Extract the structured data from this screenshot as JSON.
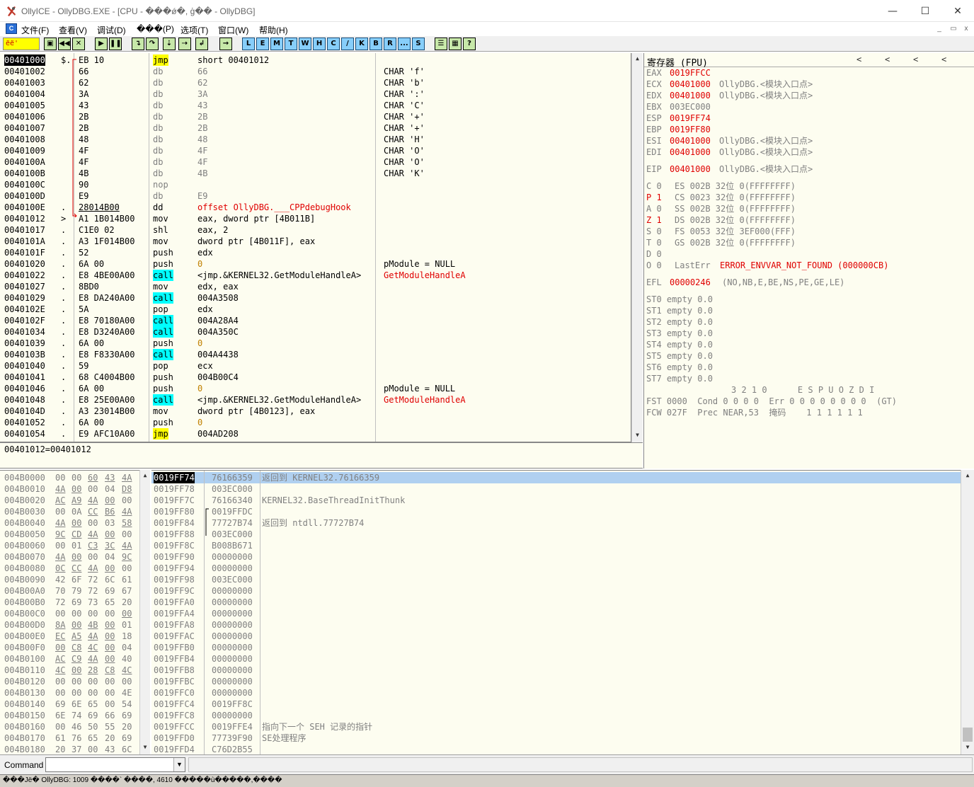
{
  "window": {
    "title": "OllyICE - OllyDBG.EXE - [CPU - ���ǿ�, ģ�� - OllyDBG]",
    "min": "—",
    "max": "☐",
    "close": "✕"
  },
  "menu": {
    "items": [
      "文件(F)",
      "查看(V)",
      "调试(D)",
      "���(P)",
      "选项(T)",
      "窗口(W)",
      "帮助(H)"
    ],
    "mdi": [
      "_",
      "▭",
      "x"
    ]
  },
  "toolbar": {
    "status_text": "ёё'",
    "letters": [
      "L",
      "E",
      "M",
      "T",
      "W",
      "H",
      "C",
      "/",
      "K",
      "B",
      "R",
      "...",
      "S"
    ]
  },
  "disasm": {
    "rows": [
      {
        "addr": "00401000",
        "m": "$.",
        "hex": "EB 10",
        "op": "jmp",
        "arg": "short 00401012",
        "cmt": "",
        "sel": true
      },
      {
        "addr": "00401002",
        "m": "",
        "hex": "66",
        "op": "db",
        "arg": "66",
        "cmt": "CHAR 'f'"
      },
      {
        "addr": "00401003",
        "m": "",
        "hex": "62",
        "op": "db",
        "arg": "62",
        "cmt": "CHAR 'b'"
      },
      {
        "addr": "00401004",
        "m": "",
        "hex": "3A",
        "op": "db",
        "arg": "3A",
        "cmt": "CHAR ':'"
      },
      {
        "addr": "00401005",
        "m": "",
        "hex": "43",
        "op": "db",
        "arg": "43",
        "cmt": "CHAR 'C'"
      },
      {
        "addr": "00401006",
        "m": "",
        "hex": "2B",
        "op": "db",
        "arg": "2B",
        "cmt": "CHAR '+'"
      },
      {
        "addr": "00401007",
        "m": "",
        "hex": "2B",
        "op": "db",
        "arg": "2B",
        "cmt": "CHAR '+'"
      },
      {
        "addr": "00401008",
        "m": "",
        "hex": "48",
        "op": "db",
        "arg": "48",
        "cmt": "CHAR 'H'"
      },
      {
        "addr": "00401009",
        "m": "",
        "hex": "4F",
        "op": "db",
        "arg": "4F",
        "cmt": "CHAR 'O'"
      },
      {
        "addr": "0040100A",
        "m": "",
        "hex": "4F",
        "op": "db",
        "arg": "4F",
        "cmt": "CHAR 'O'"
      },
      {
        "addr": "0040100B",
        "m": "",
        "hex": "4B",
        "op": "db",
        "arg": "4B",
        "cmt": "CHAR 'K'"
      },
      {
        "addr": "0040100C",
        "m": "",
        "hex": "90",
        "op": "nop",
        "arg": "",
        "cmt": ""
      },
      {
        "addr": "0040100D",
        "m": "",
        "hex": "E9",
        "op": "db",
        "arg": "E9",
        "cmt": ""
      },
      {
        "addr": "0040100E",
        "m": ".",
        "hex": "28014B00",
        "op": "dd",
        "arg": "offset OllyDBG.___CPPdebugHook",
        "cmt": ""
      },
      {
        "addr": "00401012",
        "m": ">",
        "hex": "A1 1B014B00",
        "op": "mov",
        "arg": "eax, dword ptr [4B011B]",
        "cmt": ""
      },
      {
        "addr": "00401017",
        "m": ".",
        "hex": "C1E0 02",
        "op": "shl",
        "arg": "eax, 2",
        "cmt": ""
      },
      {
        "addr": "0040101A",
        "m": ".",
        "hex": "A3 1F014B00",
        "op": "mov",
        "arg": "dword ptr [4B011F], eax",
        "cmt": ""
      },
      {
        "addr": "0040101F",
        "m": ".",
        "hex": "52",
        "op": "push",
        "arg": "edx",
        "cmt": ""
      },
      {
        "addr": "00401020",
        "m": ".",
        "hex": "6A 00",
        "op": "push",
        "arg": "0",
        "cmt": "pModule = NULL"
      },
      {
        "addr": "00401022",
        "m": ".",
        "hex": "E8 4BE00A00",
        "op": "call",
        "arg": "<jmp.&KERNEL32.GetModuleHandleA>",
        "cmt": "GetModuleHandleA"
      },
      {
        "addr": "00401027",
        "m": ".",
        "hex": "8BD0",
        "op": "mov",
        "arg": "edx, eax",
        "cmt": ""
      },
      {
        "addr": "00401029",
        "m": ".",
        "hex": "E8 DA240A00",
        "op": "call",
        "arg": "004A3508",
        "cmt": ""
      },
      {
        "addr": "0040102E",
        "m": ".",
        "hex": "5A",
        "op": "pop",
        "arg": "edx",
        "cmt": ""
      },
      {
        "addr": "0040102F",
        "m": ".",
        "hex": "E8 70180A00",
        "op": "call",
        "arg": "004A28A4",
        "cmt": ""
      },
      {
        "addr": "00401034",
        "m": ".",
        "hex": "E8 D3240A00",
        "op": "call",
        "arg": "004A350C",
        "cmt": ""
      },
      {
        "addr": "00401039",
        "m": ".",
        "hex": "6A 00",
        "op": "push",
        "arg": "0",
        "cmt": ""
      },
      {
        "addr": "0040103B",
        "m": ".",
        "hex": "E8 F8330A00",
        "op": "call",
        "arg": "004A4438",
        "cmt": ""
      },
      {
        "addr": "00401040",
        "m": ".",
        "hex": "59",
        "op": "pop",
        "arg": "ecx",
        "cmt": ""
      },
      {
        "addr": "00401041",
        "m": ".",
        "hex": "68 C4004B00",
        "op": "push",
        "arg": "004B00C4",
        "cmt": ""
      },
      {
        "addr": "00401046",
        "m": ".",
        "hex": "6A 00",
        "op": "push",
        "arg": "0",
        "cmt": "pModule = NULL"
      },
      {
        "addr": "00401048",
        "m": ".",
        "hex": "E8 25E00A00",
        "op": "call",
        "arg": "<jmp.&KERNEL32.GetModuleHandleA>",
        "cmt": "GetModuleHandleA"
      },
      {
        "addr": "0040104D",
        "m": ".",
        "hex": "A3 23014B00",
        "op": "mov",
        "arg": "dword ptr [4B0123], eax",
        "cmt": ""
      },
      {
        "addr": "00401052",
        "m": ".",
        "hex": "6A 00",
        "op": "push",
        "arg": "0",
        "cmt": ""
      },
      {
        "addr": "00401054",
        "m": ".",
        "hex": "E9 AFC10A00",
        "op": "jmp",
        "arg": "004AD208",
        "cmt": ""
      }
    ],
    "hint": "00401012=00401012"
  },
  "registers": {
    "header": "寄存器 (FPU)",
    "nav": [
      "<",
      "<",
      "<",
      "<"
    ],
    "gp": [
      {
        "name": "EAX",
        "val": "0019FFCC",
        "info": "",
        "red": true
      },
      {
        "name": "ECX",
        "val": "00401000",
        "info": "OllyDBG.<模块入口点>",
        "red": true
      },
      {
        "name": "EDX",
        "val": "00401000",
        "info": "OllyDBG.<模块入口点>",
        "red": true
      },
      {
        "name": "EBX",
        "val": "003EC000",
        "info": "",
        "red": false
      },
      {
        "name": "ESP",
        "val": "0019FF74",
        "info": "",
        "red": true
      },
      {
        "name": "EBP",
        "val": "0019FF80",
        "info": "",
        "red": true
      },
      {
        "name": "ESI",
        "val": "00401000",
        "info": "OllyDBG.<模块入口点>",
        "red": true
      },
      {
        "name": "EDI",
        "val": "00401000",
        "info": "OllyDBG.<模块入口点>",
        "red": true
      }
    ],
    "eip": {
      "name": "EIP",
      "val": "00401000",
      "info": "OllyDBG.<模块入口点>"
    },
    "flags": [
      {
        "f": "C 0",
        "seg": "ES 002B 32位 0(FFFFFFFF)",
        "red": false
      },
      {
        "f": "P 1",
        "seg": "CS 0023 32位 0(FFFFFFFF)",
        "red": true
      },
      {
        "f": "A 0",
        "seg": "SS 002B 32位 0(FFFFFFFF)",
        "red": false
      },
      {
        "f": "Z 1",
        "seg": "DS 002B 32位 0(FFFFFFFF)",
        "red": true
      },
      {
        "f": "S 0",
        "seg": "FS 0053 32位 3EF000(FFF)",
        "red": false
      },
      {
        "f": "T 0",
        "seg": "GS 002B 32位 0(FFFFFFFF)",
        "red": false
      },
      {
        "f": "D 0",
        "seg": "",
        "red": false
      }
    ],
    "lasterr": {
      "f": "O 0",
      "label": "LastErr",
      "val": "ERROR_ENVVAR_NOT_FOUND (000000CB)"
    },
    "efl": {
      "label": "EFL",
      "val": "00000246",
      "info": "(NO,NB,E,BE,NS,PE,GE,LE)"
    },
    "st": [
      "ST0 empty 0.0",
      "ST1 empty 0.0",
      "ST2 empty 0.0",
      "ST3 empty 0.0",
      "ST4 empty 0.0",
      "ST5 empty 0.0",
      "ST6 empty 0.0",
      "ST7 empty 0.0"
    ],
    "fpu_head": "3 2 1 0      E S P U O Z D I",
    "fst": "FST 0000  Cond 0 0 0 0  Err 0 0 0 0 0 0 0 0  (GT)",
    "fcw": "FCW 027F  Prec NEAR,53  掩码    1 1 1 1 1 1"
  },
  "dump": {
    "rows": [
      {
        "a": "004B0000",
        "b": [
          "00",
          "00",
          "60",
          "43",
          "4A"
        ],
        "u": [
          2,
          3,
          4
        ]
      },
      {
        "a": "004B0010",
        "b": [
          "4A",
          "00",
          "00",
          "04",
          "D8"
        ],
        "u": [
          0,
          1,
          4
        ]
      },
      {
        "a": "004B0020",
        "b": [
          "AC",
          "A9",
          "4A",
          "00",
          "00"
        ],
        "u": [
          0,
          1,
          2,
          3
        ]
      },
      {
        "a": "004B0030",
        "b": [
          "00",
          "0A",
          "CC",
          "B6",
          "4A"
        ],
        "u": [
          2,
          3,
          4
        ]
      },
      {
        "a": "004B0040",
        "b": [
          "4A",
          "00",
          "00",
          "03",
          "58"
        ],
        "u": [
          0,
          1,
          4
        ]
      },
      {
        "a": "004B0050",
        "b": [
          "9C",
          "CD",
          "4A",
          "00",
          "00"
        ],
        "u": [
          0,
          1,
          2,
          3
        ]
      },
      {
        "a": "004B0060",
        "b": [
          "00",
          "01",
          "C3",
          "3C",
          "4A"
        ],
        "u": [
          2,
          3,
          4
        ]
      },
      {
        "a": "004B0070",
        "b": [
          "4A",
          "00",
          "00",
          "04",
          "9C"
        ],
        "u": [
          0,
          1,
          4
        ]
      },
      {
        "a": "004B0080",
        "b": [
          "0C",
          "CC",
          "4A",
          "00",
          "00"
        ],
        "u": [
          0,
          1,
          2,
          3
        ]
      },
      {
        "a": "004B0090",
        "b": [
          "42",
          "6F",
          "72",
          "6C",
          "61"
        ],
        "u": []
      },
      {
        "a": "004B00A0",
        "b": [
          "70",
          "79",
          "72",
          "69",
          "67"
        ],
        "u": []
      },
      {
        "a": "004B00B0",
        "b": [
          "72",
          "69",
          "73",
          "65",
          "20"
        ],
        "u": []
      },
      {
        "a": "004B00C0",
        "b": [
          "00",
          "00",
          "00",
          "00",
          "00"
        ],
        "u": [
          4
        ]
      },
      {
        "a": "004B00D0",
        "b": [
          "8A",
          "00",
          "4B",
          "00",
          "01"
        ],
        "u": [
          0,
          1,
          2,
          3
        ]
      },
      {
        "a": "004B00E0",
        "b": [
          "EC",
          "A5",
          "4A",
          "00",
          "18"
        ],
        "u": [
          0,
          1,
          2,
          3
        ]
      },
      {
        "a": "004B00F0",
        "b": [
          "00",
          "C8",
          "4C",
          "00",
          "04"
        ],
        "u": [
          0,
          1,
          2,
          3
        ]
      },
      {
        "a": "004B0100",
        "b": [
          "AC",
          "C9",
          "4A",
          "00",
          "40"
        ],
        "u": [
          0,
          1,
          2,
          3
        ]
      },
      {
        "a": "004B0110",
        "b": [
          "4C",
          "00",
          "28",
          "C8",
          "4C"
        ],
        "u": [
          0,
          1,
          2,
          3,
          4
        ]
      },
      {
        "a": "004B0120",
        "b": [
          "00",
          "00",
          "00",
          "00",
          "00"
        ],
        "u": []
      },
      {
        "a": "004B0130",
        "b": [
          "00",
          "00",
          "00",
          "00",
          "4E"
        ],
        "u": []
      },
      {
        "a": "004B0140",
        "b": [
          "69",
          "6E",
          "65",
          "00",
          "54"
        ],
        "u": []
      },
      {
        "a": "004B0150",
        "b": [
          "6E",
          "74",
          "69",
          "66",
          "69"
        ],
        "u": []
      },
      {
        "a": "004B0160",
        "b": [
          "00",
          "46",
          "50",
          "55",
          "20"
        ],
        "u": []
      },
      {
        "a": "004B0170",
        "b": [
          "61",
          "76",
          "65",
          "20",
          "69"
        ],
        "u": []
      },
      {
        "a": "004B0180",
        "b": [
          "20",
          "37",
          "00",
          "43",
          "6C"
        ],
        "u": []
      }
    ]
  },
  "stack": {
    "rows": [
      {
        "a": "0019FF74",
        "v": "76166359",
        "c": "返回到 KERNEL32.76166359",
        "sel": true
      },
      {
        "a": "0019FF78",
        "v": "003EC000",
        "c": ""
      },
      {
        "a": "0019FF7C",
        "v": "76166340",
        "c": "KERNEL32.BaseThreadInitThunk"
      },
      {
        "a": "0019FF80",
        "v": "0019FFDC",
        "c": "",
        "br": true
      },
      {
        "a": "0019FF84",
        "v": "77727B74",
        "c": "返回到 ntdll.77727B74"
      },
      {
        "a": "0019FF88",
        "v": "003EC000",
        "c": ""
      },
      {
        "a": "0019FF8C",
        "v": "B008B671",
        "c": ""
      },
      {
        "a": "0019FF90",
        "v": "00000000",
        "c": ""
      },
      {
        "a": "0019FF94",
        "v": "00000000",
        "c": ""
      },
      {
        "a": "0019FF98",
        "v": "003EC000",
        "c": ""
      },
      {
        "a": "0019FF9C",
        "v": "00000000",
        "c": ""
      },
      {
        "a": "0019FFA0",
        "v": "00000000",
        "c": ""
      },
      {
        "a": "0019FFA4",
        "v": "00000000",
        "c": ""
      },
      {
        "a": "0019FFA8",
        "v": "00000000",
        "c": ""
      },
      {
        "a": "0019FFAC",
        "v": "00000000",
        "c": ""
      },
      {
        "a": "0019FFB0",
        "v": "00000000",
        "c": ""
      },
      {
        "a": "0019FFB4",
        "v": "00000000",
        "c": ""
      },
      {
        "a": "0019FFB8",
        "v": "00000000",
        "c": ""
      },
      {
        "a": "0019FFBC",
        "v": "00000000",
        "c": ""
      },
      {
        "a": "0019FFC0",
        "v": "00000000",
        "c": ""
      },
      {
        "a": "0019FFC4",
        "v": "0019FF8C",
        "c": ""
      },
      {
        "a": "0019FFC8",
        "v": "00000000",
        "c": ""
      },
      {
        "a": "0019FFCC",
        "v": "0019FFE4",
        "c": "指向下一个 SEH 记录的指针"
      },
      {
        "a": "0019FFD0",
        "v": "77739F90",
        "c": "SE处理程序"
      },
      {
        "a": "0019FFD4",
        "v": "C76D2B55",
        "c": ""
      }
    ]
  },
  "command": {
    "label": "Command",
    "value": ""
  },
  "statusbar": {
    "text": "���Jё� OllyDBG: 1009 ����` ����, 4610 �����ù�����,����"
  }
}
